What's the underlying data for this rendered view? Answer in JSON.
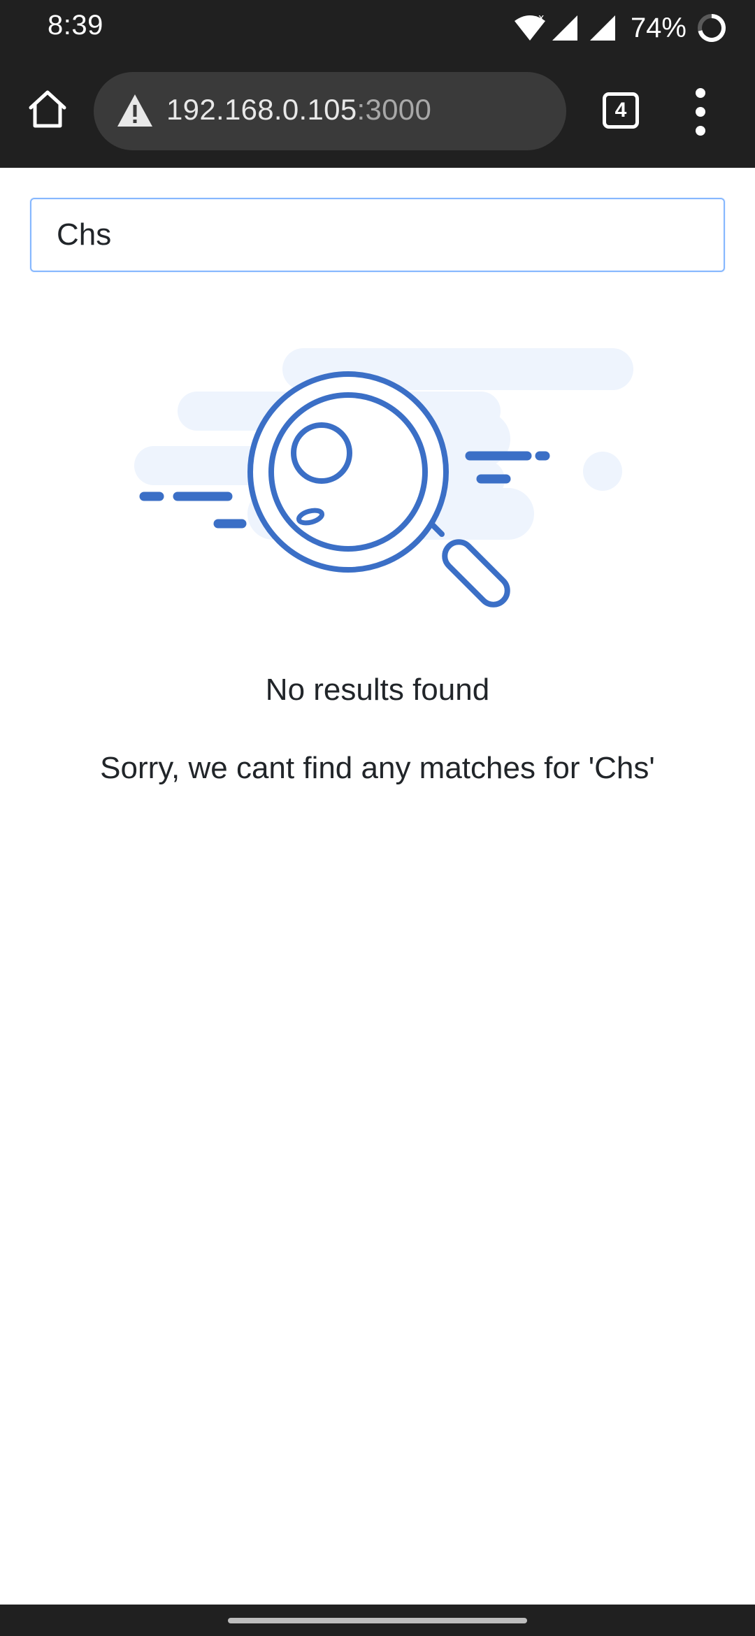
{
  "status_bar": {
    "time": "8:39",
    "battery": "74%",
    "icons": [
      "wifi-icon",
      "cell-signal-icon",
      "cell-signal-icon",
      "battery-icon"
    ]
  },
  "browser": {
    "url_host": "192.168.0.105",
    "url_port": ":3000",
    "tab_count": "4",
    "icons": [
      "home-icon",
      "warning-icon",
      "tab-switcher-icon",
      "more-menu-icon"
    ]
  },
  "search": {
    "value": "Chs"
  },
  "empty_state": {
    "title": "No results found",
    "message": "Sorry, we cant find any matches for 'Chs'",
    "illustration_icon": "magnifying-glass-icon"
  },
  "colors": {
    "system_bar": "#202020",
    "omnibox": "#3a3a3a",
    "accent": "#3b6fc6",
    "illustration_bg": "#eef4fd",
    "focus_border": "#86b7fe",
    "text": "#212529"
  }
}
